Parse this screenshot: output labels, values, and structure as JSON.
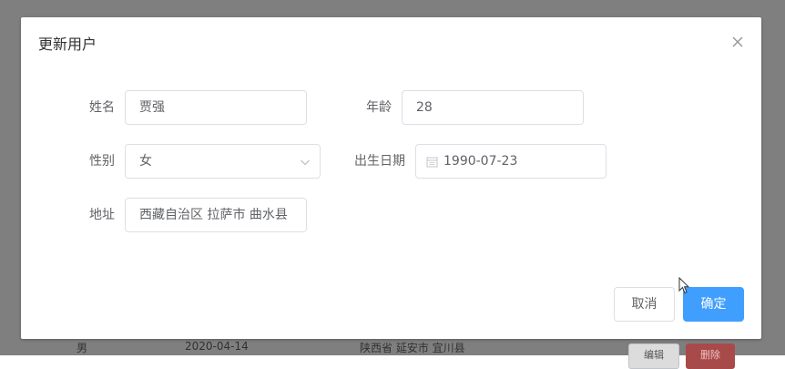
{
  "background": {
    "row": {
      "gender": "男",
      "date": "2020-04-14",
      "address": "陕西省 延安市 宜川县",
      "edit_label": "编辑",
      "delete_label": "删除"
    }
  },
  "dialog": {
    "title": "更新用户",
    "close_icon": "close-icon",
    "fields": {
      "name_label": "姓名",
      "name_value": "贾强",
      "age_label": "年龄",
      "age_value": "28",
      "gender_label": "性别",
      "gender_value": "女",
      "birthdate_label": "出生日期",
      "birthdate_value": "1990-07-23",
      "address_label": "地址",
      "address_value": "西藏自治区 拉萨市 曲水县"
    },
    "footer": {
      "cancel_label": "取消",
      "confirm_label": "确定"
    }
  },
  "colors": {
    "primary": "#409eff",
    "overlay": "#7f7f7f",
    "danger": "#f56c6c"
  }
}
